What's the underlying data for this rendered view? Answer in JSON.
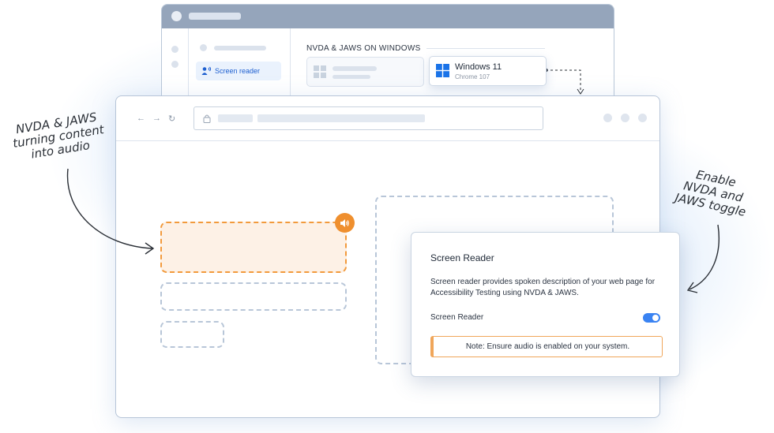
{
  "back_window": {
    "sidebar_item_label": "Screen reader",
    "section_heading": "NVDA & JAWS ON WINDOWS",
    "selected_os": {
      "name": "Windows 11",
      "browser": "Chrome 107"
    }
  },
  "dialog": {
    "title": "Screen Reader",
    "description": "Screen reader provides spoken description of your web page for Accessibility Testing using NVDA & JAWS.",
    "toggle_label": "Screen Reader",
    "toggle_on": true,
    "note": "Note: Ensure audio is enabled on your system."
  },
  "annotations": {
    "left": [
      "NVDA & JAWS",
      "turning content",
      "into audio"
    ],
    "right": [
      "Enable",
      "NVDA and",
      "JAWS toggle"
    ]
  },
  "colors": {
    "accent_blue": "#3a83f2",
    "accent_orange": "#ef8f2e",
    "titlebar": "#95a5bb"
  },
  "icons": {
    "sidebar": "user-speaker-icon",
    "windows": "windows-logo-icon",
    "speaker": "speaker-icon",
    "lock": "lock-icon"
  }
}
